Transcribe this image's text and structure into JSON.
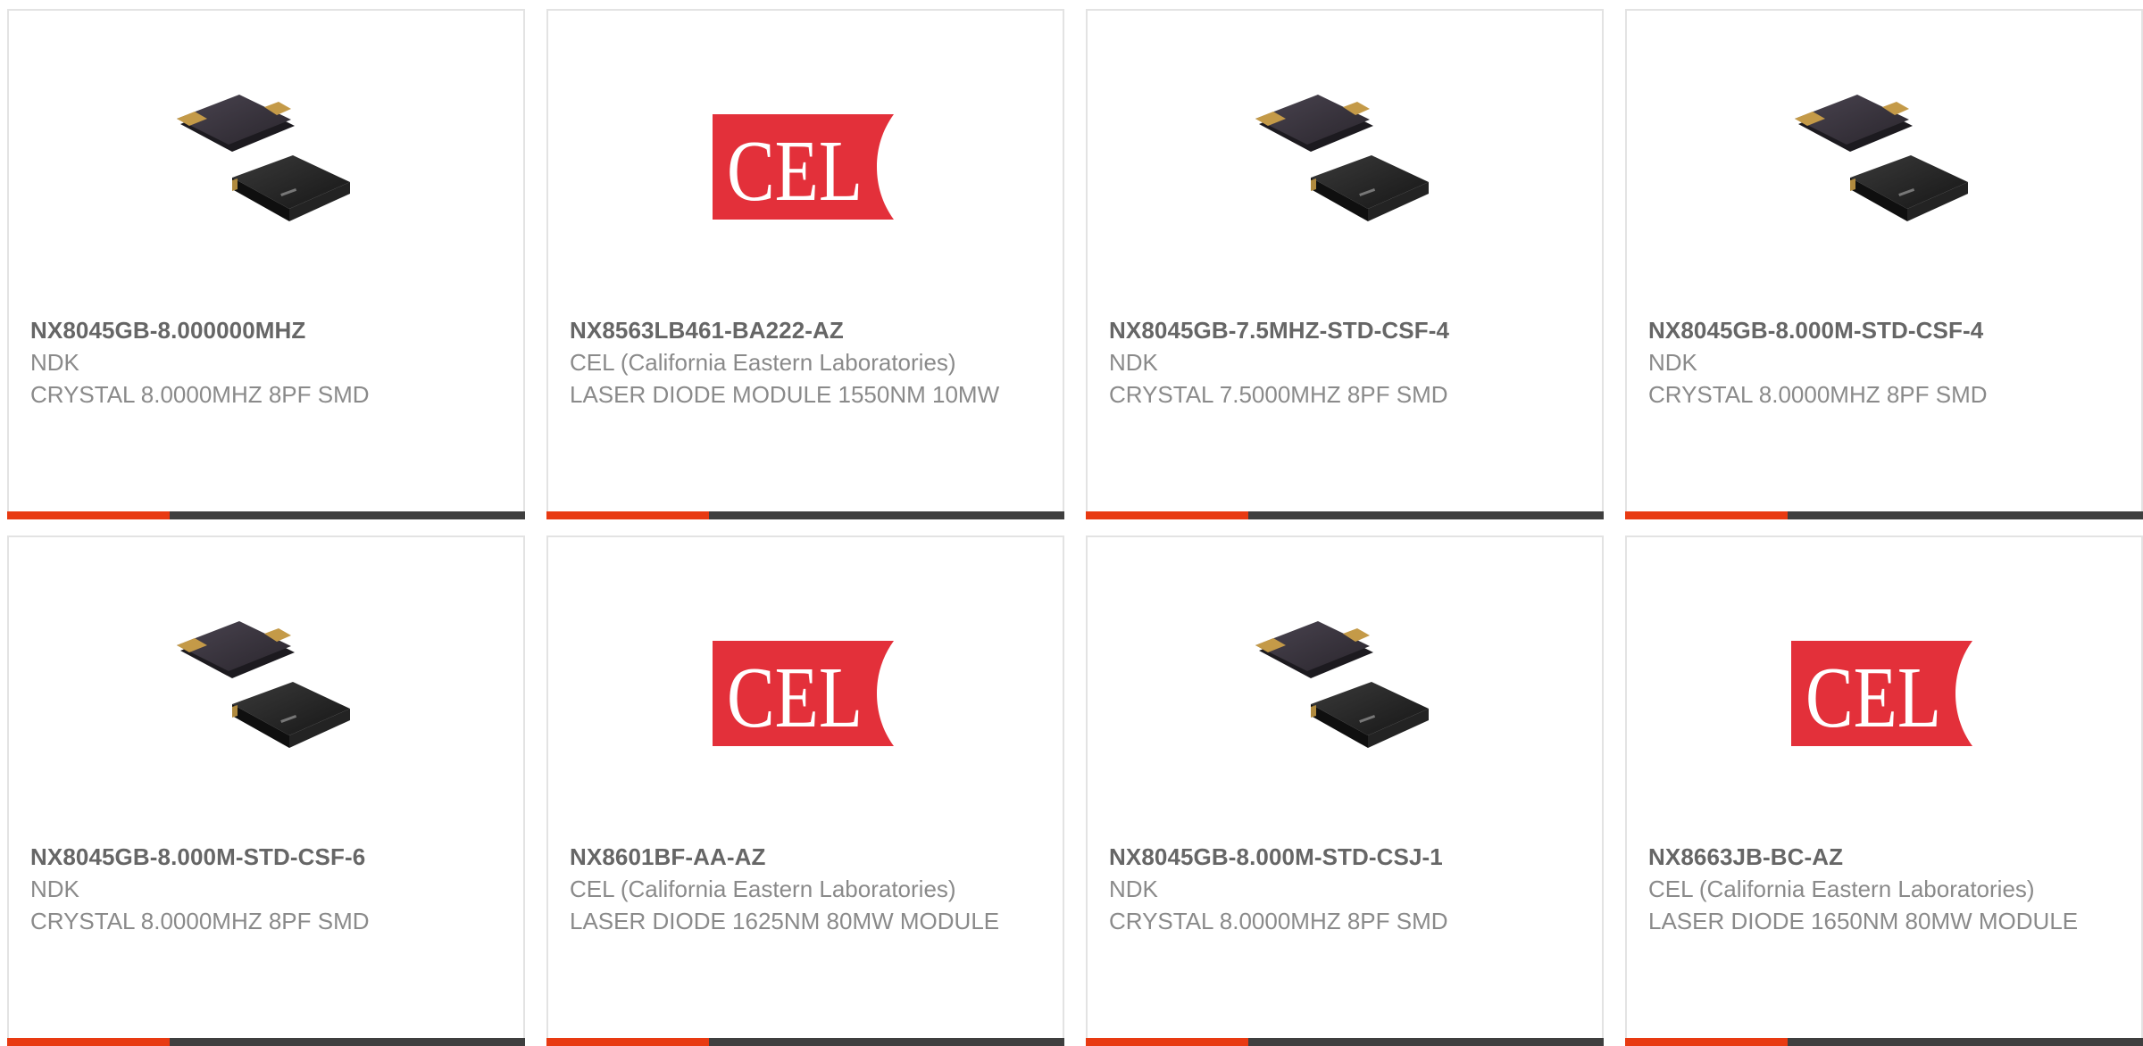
{
  "brand": {
    "accent_color": "#e83a12",
    "bar_color": "#3f3f3f",
    "logo_red": "#e3303a"
  },
  "products": [
    {
      "part": "NX8045GB-8.000000MHZ",
      "manufacturer": "NDK",
      "description": "CRYSTAL 8.0000MHZ 8PF SMD",
      "image": "crystal-image"
    },
    {
      "part": "NX8563LB461-BA222-AZ",
      "manufacturer": "CEL (California Eastern Laboratories)",
      "description": "LASER DIODE MODULE 1550NM 10MW",
      "image": "cel-logo",
      "logo_text": "CEL"
    },
    {
      "part": "NX8045GB-7.5MHZ-STD-CSF-4",
      "manufacturer": "NDK",
      "description": "CRYSTAL 7.5000MHZ 8PF SMD",
      "image": "crystal-image"
    },
    {
      "part": "NX8045GB-8.000M-STD-CSF-4",
      "manufacturer": "NDK",
      "description": "CRYSTAL 8.0000MHZ 8PF SMD",
      "image": "crystal-image"
    },
    {
      "part": "NX8045GB-8.000M-STD-CSF-6",
      "manufacturer": "NDK",
      "description": "CRYSTAL 8.0000MHZ 8PF SMD",
      "image": "crystal-image"
    },
    {
      "part": "NX8601BF-AA-AZ",
      "manufacturer": "CEL (California Eastern Laboratories)",
      "description": "LASER DIODE 1625NM 80MW MODULE",
      "image": "cel-logo",
      "logo_text": "CEL"
    },
    {
      "part": "NX8045GB-8.000M-STD-CSJ-1",
      "manufacturer": "NDK",
      "description": "CRYSTAL 8.0000MHZ 8PF SMD",
      "image": "crystal-image"
    },
    {
      "part": "NX8663JB-BC-AZ",
      "manufacturer": "CEL (California Eastern Laboratories)",
      "description": "LASER DIODE 1650NM 80MW MODULE",
      "image": "cel-logo",
      "logo_text": "CEL"
    }
  ]
}
